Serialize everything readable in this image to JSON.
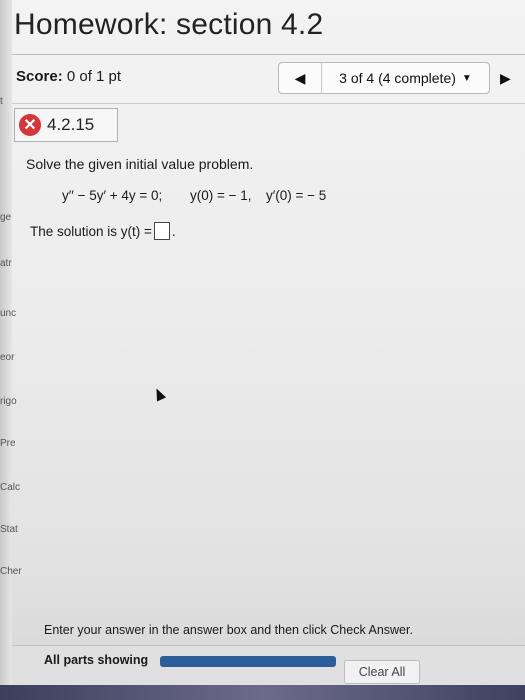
{
  "header": {
    "title": "Homework: section 4.2"
  },
  "left_fragments": [
    "ge",
    "atr",
    "unc",
    "eor",
    "rigo",
    "Pre",
    "Calc",
    "Stat",
    "Cher"
  ],
  "score_bar": {
    "score_label": "Score:",
    "score_value": "0 of 1 pt",
    "prev_icon": "left-triangle",
    "position_text": "3 of 4 (4 complete)",
    "dropdown_icon": "down-triangle",
    "next_icon": "right-triangle"
  },
  "question": {
    "status_icon": "x-circle",
    "status_color": "#d4363a",
    "id": "4.2.15",
    "prompt": "Solve the given initial value problem.",
    "equation": "y′′ − 5y′ + 4y = 0;",
    "ic1": "y(0) = − 1,",
    "ic2": "y′(0) = − 5",
    "solution_label": "The solution is y(t) =",
    "solution_answer": "",
    "solution_end": "."
  },
  "footer": {
    "instructions": "Enter your answer in the answer box and then click Check Answer.",
    "parts_label": "All parts showing",
    "progress_color": "#2c5f99",
    "clear_label": "Clear All"
  }
}
